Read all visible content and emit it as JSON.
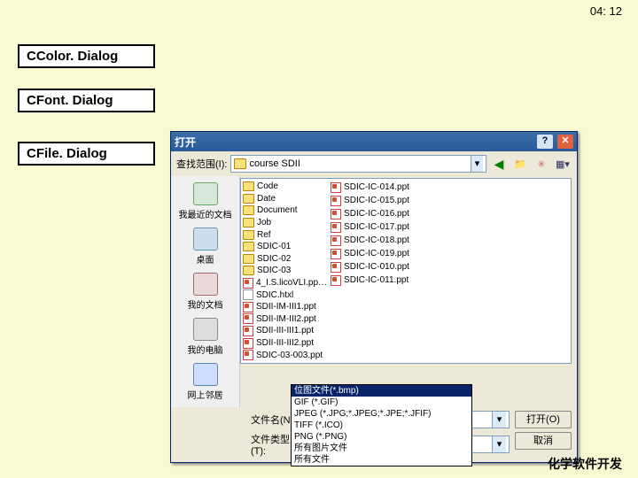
{
  "timestamp": "04: 12",
  "footer": "化学软件开发",
  "categories": {
    "color": "CColor. Dialog",
    "font": "CFont. Dialog",
    "file": "CFile. Dialog"
  },
  "dialog": {
    "title": "打开",
    "look_in_label": "查找范围(I):",
    "look_in_value": "course SDII",
    "places": {
      "recent": "我最近的文档",
      "desktop": "桌面",
      "docs": "我的文档",
      "pc": "我的电脑",
      "net": "网上邻居"
    },
    "files_col1": [
      {
        "name": "Code",
        "type": "folder"
      },
      {
        "name": "Date",
        "type": "folder"
      },
      {
        "name": "Document",
        "type": "folder"
      },
      {
        "name": "Job",
        "type": "folder"
      },
      {
        "name": "Ref",
        "type": "folder"
      },
      {
        "name": "SDIC-01",
        "type": "folder"
      },
      {
        "name": "SDIC-02",
        "type": "folder"
      },
      {
        "name": "SDIC-03",
        "type": "folder"
      },
      {
        "name": "4_I.S.licoVLI.pp…",
        "type": "ppt"
      },
      {
        "name": "SDIC.htxl",
        "type": "file"
      },
      {
        "name": "SDII-IM-III1.ppt",
        "type": "ppt"
      },
      {
        "name": "SDII-IM-III2.ppt",
        "type": "ppt"
      },
      {
        "name": "SDII-III-III1.ppt",
        "type": "ppt"
      },
      {
        "name": "SDII-III-III2.ppt",
        "type": "ppt"
      },
      {
        "name": "SDIC-03-003.ppt",
        "type": "ppt"
      }
    ],
    "files_col2": [
      {
        "name": "SDIC-IC-014.ppt",
        "type": "ppt"
      },
      {
        "name": "SDIC-IC-015.ppt",
        "type": "ppt"
      },
      {
        "name": "SDIC-IC-016.ppt",
        "type": "ppt"
      },
      {
        "name": "SDIC-IC-017.ppt",
        "type": "ppt"
      },
      {
        "name": "SDIC-IC-018.ppt",
        "type": "ppt"
      },
      {
        "name": "SDIC-IC-019.ppt",
        "type": "ppt"
      },
      {
        "name": "SDIC-IC-010.ppt",
        "type": "ppt"
      },
      {
        "name": "SDIC-IC-011.ppt",
        "type": "ppt"
      }
    ],
    "filename_label": "文件名(N):",
    "filename_value": "",
    "filetype_label": "文件类型(T):",
    "filetype_value": "所有文件",
    "open_button": "打开(O)",
    "cancel_button": "取消",
    "filter_options": [
      "位图文件(*.bmp)",
      "GIF (*.GIF)",
      "JPEG (*.JPG;*.JPEG;*.JPE;*.JFIF)",
      "TIFF (*.ICO)",
      "PNG (*.PNG)",
      "所有图片文件",
      "所有文件"
    ],
    "filter_selected_index": 0
  }
}
